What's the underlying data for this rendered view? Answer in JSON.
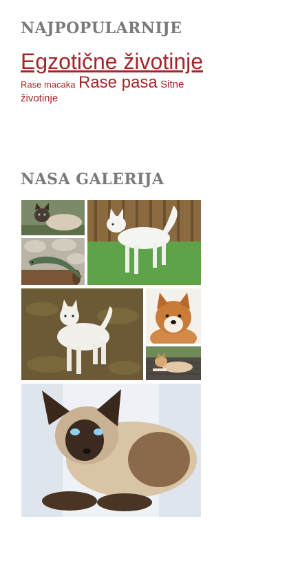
{
  "sections": {
    "popular_title": "NAJPOPULARNIJE",
    "gallery_title": "NASA GALERIJA"
  },
  "tags": [
    {
      "label": "Egzotične životinje",
      "weight": "xl"
    },
    {
      "label": "Rase macaka",
      "weight": "sm"
    },
    {
      "label": "Rase pasa",
      "weight": "lg"
    },
    {
      "label": "Sitne životinje",
      "weight": "md"
    }
  ],
  "gallery": [
    {
      "icon": "siamese-cat-image"
    },
    {
      "icon": "white-dog-image"
    },
    {
      "icon": "lizard-image"
    },
    {
      "icon": "white-akita-image"
    },
    {
      "icon": "akita-puppy-image"
    },
    {
      "icon": "lying-akita-image"
    },
    {
      "icon": "siamese-cat-large-image"
    }
  ],
  "colors": {
    "tag_link": "#a3272a",
    "section_title": "#7a7a7a",
    "background": "#ffffff"
  }
}
